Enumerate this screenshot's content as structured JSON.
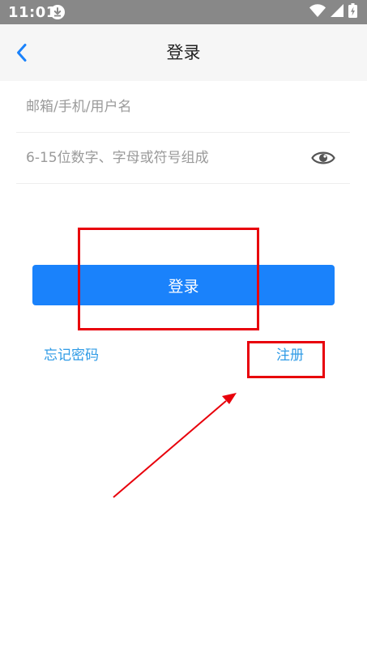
{
  "status_bar": {
    "time": "11:01",
    "icons": [
      "download-icon",
      "wifi-icon",
      "signal-icon",
      "battery-charging-icon"
    ]
  },
  "header": {
    "title": "登录",
    "back_icon": "chevron-left-icon"
  },
  "form": {
    "account_placeholder": "邮箱/手机/用户名",
    "password_placeholder": "6-15位数字、字母或符号组成",
    "password_toggle_icon": "eye-icon",
    "login_label": "登录"
  },
  "links": {
    "forgot_password": "忘记密码",
    "register": "注册"
  },
  "colors": {
    "accent": "#1a82fb",
    "link": "#2f9be6",
    "annotation": "#e8000b",
    "status_bar": "#888888"
  }
}
